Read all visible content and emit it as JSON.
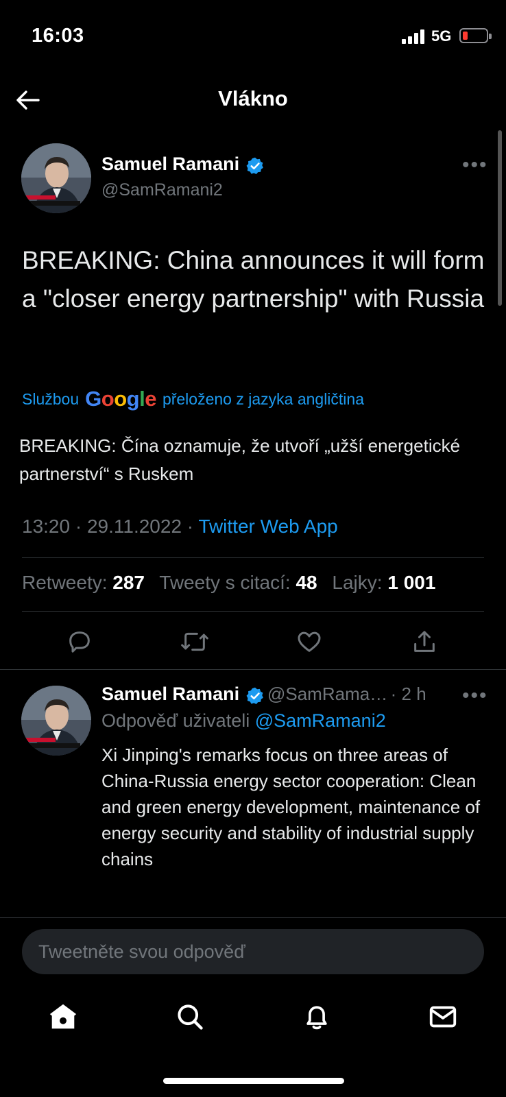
{
  "status_bar": {
    "time": "16:03",
    "network": "5G"
  },
  "header": {
    "title": "Vlákno",
    "back_icon": "arrow-left-icon"
  },
  "main_tweet": {
    "author_name": "Samuel Ramani",
    "author_handle": "@SamRamani2",
    "text": "BREAKING: China announces it will form a \"closer energy partnership\" with Russia",
    "translation_prefix": "Službou",
    "translation_provider": "Google",
    "translation_suffix": "přeloženo z jazyka angličtina",
    "translated_text": "BREAKING: Čína oznamuje, že utvoří „užší energetické partnerství“ s Ruskem",
    "timestamp": "13:20 · 29.11.2022 · ",
    "source_app": "Twitter Web App",
    "stats": {
      "retweets_label": "Retweety:",
      "retweets": "287",
      "quotes_label": "Tweety s citací:",
      "quotes": "48",
      "likes_label": "Lajky:",
      "likes": "1 001"
    }
  },
  "reply_tweet": {
    "author_name": "Samuel Ramani",
    "author_handle": "@SamRama…",
    "age": "· 2 h",
    "reply_to_label": "Odpověď uživateli",
    "reply_to_handle": "@SamRamani2",
    "text": "Xi Jinping's remarks focus on three areas of China-Russia energy sector cooperation: Clean and green energy development, maintenance of energy security and stability of industrial supply chains"
  },
  "composer": {
    "placeholder": "Tweetněte svou odpověď"
  },
  "colors": {
    "accent": "#1d9bf0",
    "background": "#000000",
    "muted": "#71767b",
    "battery_low": "#ff3b30"
  },
  "tabbar": {
    "items": [
      "home-icon",
      "search-icon",
      "bell-icon",
      "mail-icon"
    ]
  }
}
